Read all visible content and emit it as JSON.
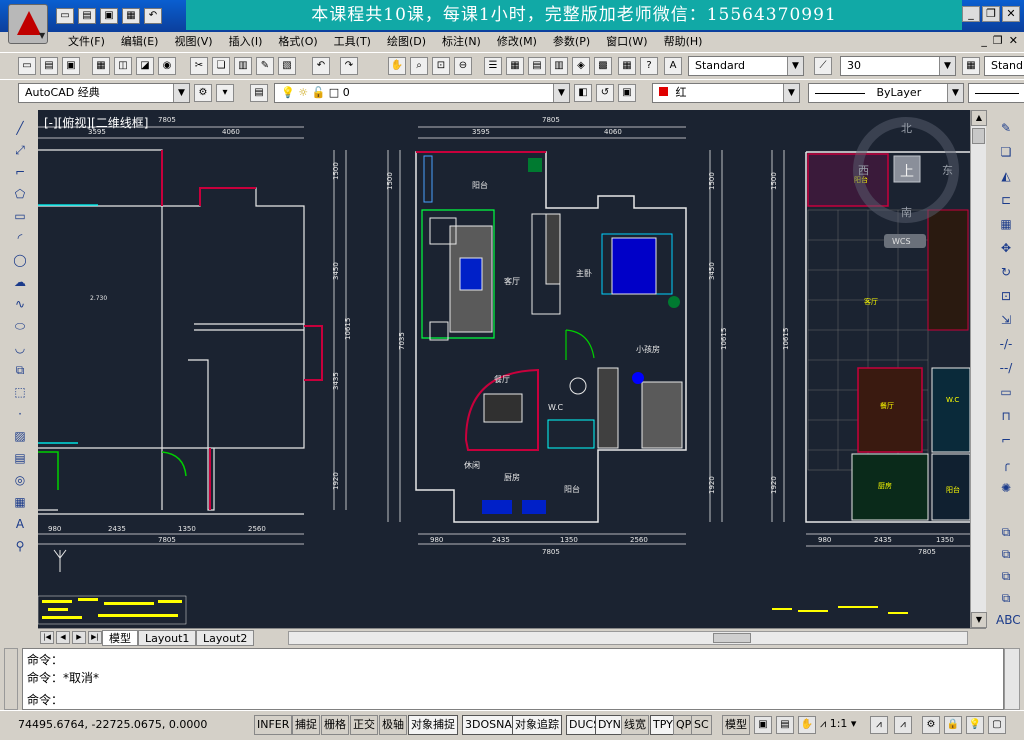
{
  "title_bar": {
    "banner_text": "本课程共10课，每课1小时，完整版加老师微信：15564370991",
    "window_buttons": [
      "_",
      "❐",
      "✕"
    ]
  },
  "menu": {
    "items": [
      "文件(F)",
      "编辑(E)",
      "视图(V)",
      "插入(I)",
      "格式(O)",
      "工具(T)",
      "绘图(D)",
      "标注(N)",
      "修改(M)",
      "参数(P)",
      "窗口(W)",
      "帮助(H)"
    ],
    "mdi_buttons": [
      "_",
      "❐",
      "✕"
    ]
  },
  "toolbar1": {
    "text_style": "Standard",
    "dim_scale": "30",
    "dim_style_partial": "Stand"
  },
  "toolbar2": {
    "workspace": "AutoCAD 经典",
    "layer": "0",
    "color": "红",
    "linetype": "ByLayer"
  },
  "viewport": {
    "label": "[-][俯视][二维线框]"
  },
  "drawing": {
    "dims_top_left": [
      "3595",
      "7805",
      "4060"
    ],
    "dims_top_mid": [
      "3595",
      "7805",
      "4060"
    ],
    "dims_bottom": [
      "980",
      "2435",
      "1350",
      "2560",
      "7805"
    ],
    "dims_bottom_mid": [
      "980",
      "2435",
      "1350",
      "2560",
      "7805"
    ],
    "dims_bottom_right": [
      "980",
      "2435",
      "1350",
      "7805"
    ],
    "dims_vertical": [
      "1500",
      "3450",
      "10615",
      "7035",
      "3435",
      "1920"
    ],
    "rooms_mid": [
      "阳台",
      "客厅",
      "主卧",
      "小孩房",
      "餐厅",
      "W.C",
      "厨房",
      "阳台",
      "休闲"
    ],
    "rooms_right": [
      "阳台",
      "客厅",
      "餐厅",
      "W.C",
      "厨房",
      "阳台"
    ],
    "level_tag": "2.730",
    "viewcube": {
      "top": "上",
      "north": "北",
      "south": "南",
      "east": "东",
      "west": "西",
      "wcs": "WCS"
    }
  },
  "layout_tabs": [
    "模型",
    "Layout1",
    "Layout2"
  ],
  "command": {
    "lines": [
      "命令：",
      "命令：*取消*",
      "命令："
    ]
  },
  "status": {
    "coordinates": "74495.6764, -22725.0675, 0.0000",
    "toggles": [
      {
        "label": "INFER",
        "on": false
      },
      {
        "label": "捕捉",
        "on": false
      },
      {
        "label": "栅格",
        "on": false
      },
      {
        "label": "正交",
        "on": false
      },
      {
        "label": "极轴",
        "on": false
      },
      {
        "label": "对象捕捉",
        "on": true
      },
      {
        "label": "3DOSNAP",
        "on": true
      },
      {
        "label": "对象追踪",
        "on": true
      },
      {
        "label": "DUCS",
        "on": true
      },
      {
        "label": "DYN",
        "on": true
      },
      {
        "label": "线宽",
        "on": false
      },
      {
        "label": "TPY",
        "on": true
      },
      {
        "label": "QP",
        "on": false
      },
      {
        "label": "SC",
        "on": false
      }
    ],
    "model_label": "模型",
    "annotation_scale": "1:1"
  },
  "colors": {
    "canvas": "#1b2331",
    "banner": "#11a9a6",
    "wall": "#ffffff",
    "accent_red": "#c8003c"
  }
}
